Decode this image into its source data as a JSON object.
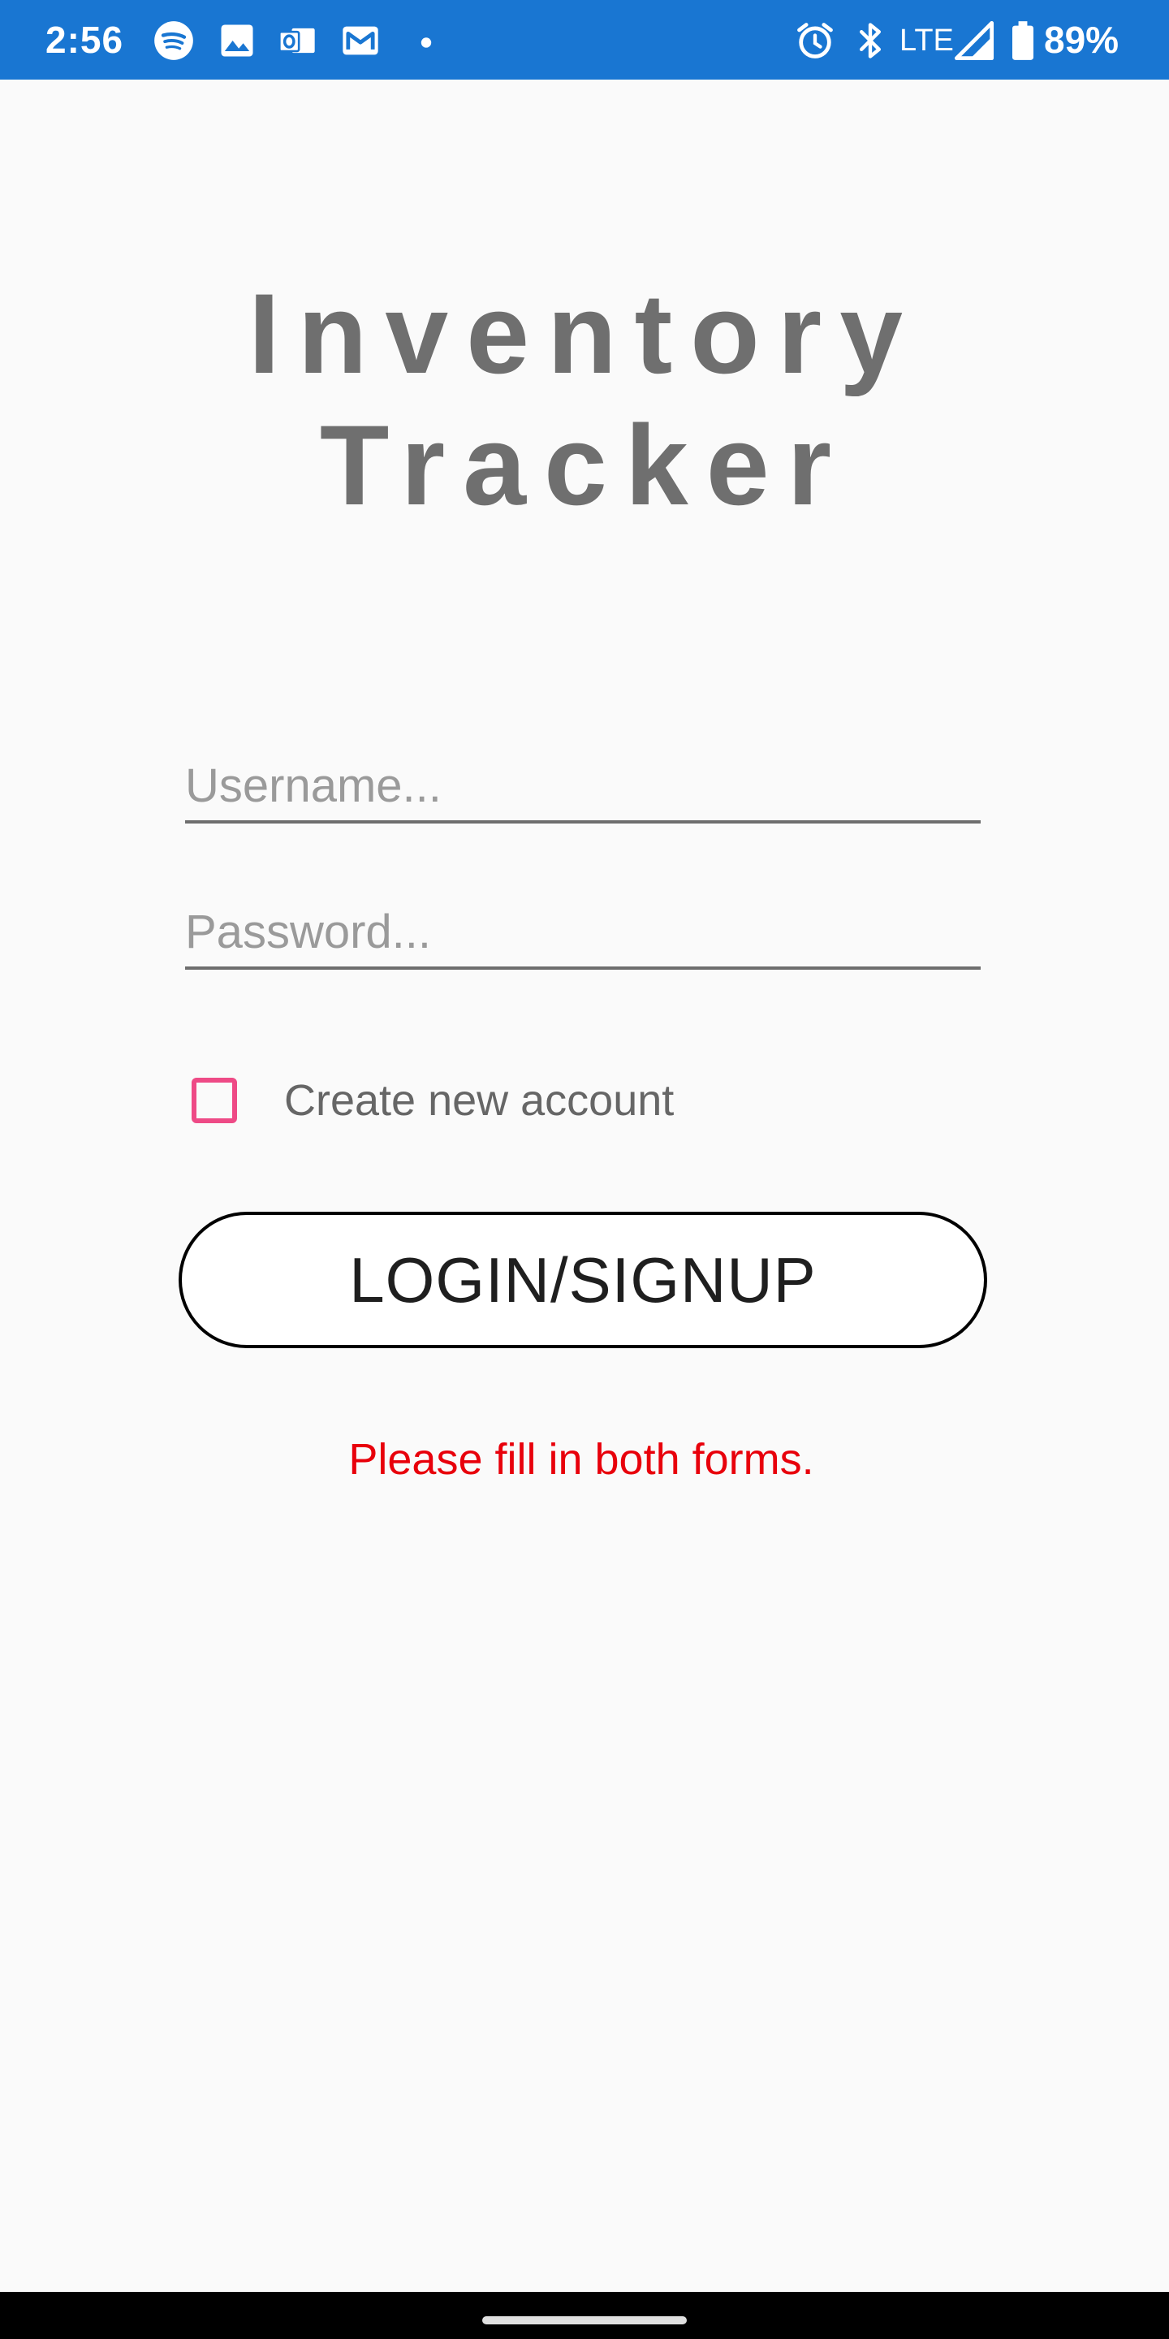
{
  "status_bar": {
    "time": "2:56",
    "network": "LTE",
    "battery": "89%",
    "notification_icons": [
      "spotify-icon",
      "image-icon",
      "outlook-icon",
      "gmail-icon",
      "dot-icon"
    ],
    "system_icons": [
      "alarm-icon",
      "bluetooth-icon",
      "signal-icon",
      "battery-icon"
    ]
  },
  "app": {
    "title": "Inventory Tracker"
  },
  "form": {
    "username_placeholder": "Username...",
    "password_placeholder": "Password...",
    "checkbox_label": "Create new account",
    "checkbox_checked": false,
    "submit_label": "LOGIN/SIGNUP",
    "error_message": "Please fill in both forms."
  },
  "colors": {
    "status_bar": "#1976d2",
    "background": "#fafafa",
    "title": "#6f6f6f",
    "checkbox_accent": "#ee4a86",
    "error": "#e8000b"
  }
}
